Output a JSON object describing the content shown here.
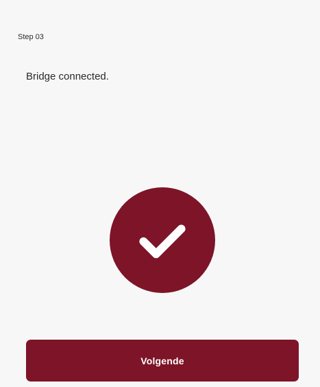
{
  "step": {
    "label": "Step 03"
  },
  "status": {
    "message": "Bridge connected.",
    "icon": "checkmark-icon",
    "accent_color": "#7d1428"
  },
  "footer": {
    "next_label": "Volgende",
    "button_color": "#7d1428"
  }
}
